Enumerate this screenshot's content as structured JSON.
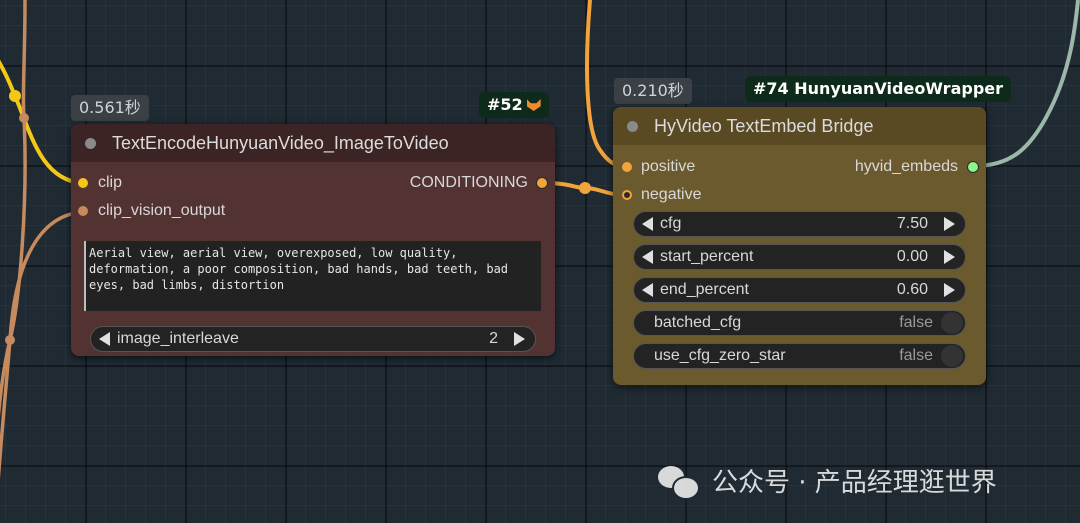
{
  "colors": {
    "clip_wire": "#f5c817",
    "clip_vision_wire": "#c58a5e",
    "conditioning_wire": "#f2a33c",
    "hyvid_wire": "#9db7a8",
    "node_left_bg": "#533232",
    "node_left_header": "#3c2424",
    "node_right_bg": "#6b5a2e",
    "node_right_header": "#5a4a24"
  },
  "node_52": {
    "time": "0.561秒",
    "badge": "#52",
    "badge_icon": "fox-icon",
    "title": "TextEncodeHunyuanVideo_ImageToVideo",
    "inputs": [
      "clip",
      "clip_vision_output"
    ],
    "output": "CONDITIONING",
    "prompt_text": "Aerial view, aerial view, overexposed, low quality, deformation, a poor composition, bad hands, bad teeth, bad eyes, bad limbs, distortion",
    "widget": {
      "label": "image_interleave",
      "value": "2"
    }
  },
  "node_74": {
    "time": "0.210秒",
    "badge": "#74 HunyuanVideoWrapper",
    "title": "HyVideo TextEmbed Bridge",
    "inputs": [
      "positive",
      "negative"
    ],
    "output": "hyvid_embeds",
    "widgets": [
      {
        "label": "cfg",
        "value": "7.50"
      },
      {
        "label": "start_percent",
        "value": "0.00"
      },
      {
        "label": "end_percent",
        "value": "0.60"
      }
    ],
    "toggles": [
      {
        "label": "batched_cfg",
        "value": "false"
      },
      {
        "label": "use_cfg_zero_star",
        "value": "false"
      }
    ]
  },
  "watermark": {
    "icon": "wechat-icon",
    "text": "公众号 · 产品经理逛世界"
  }
}
